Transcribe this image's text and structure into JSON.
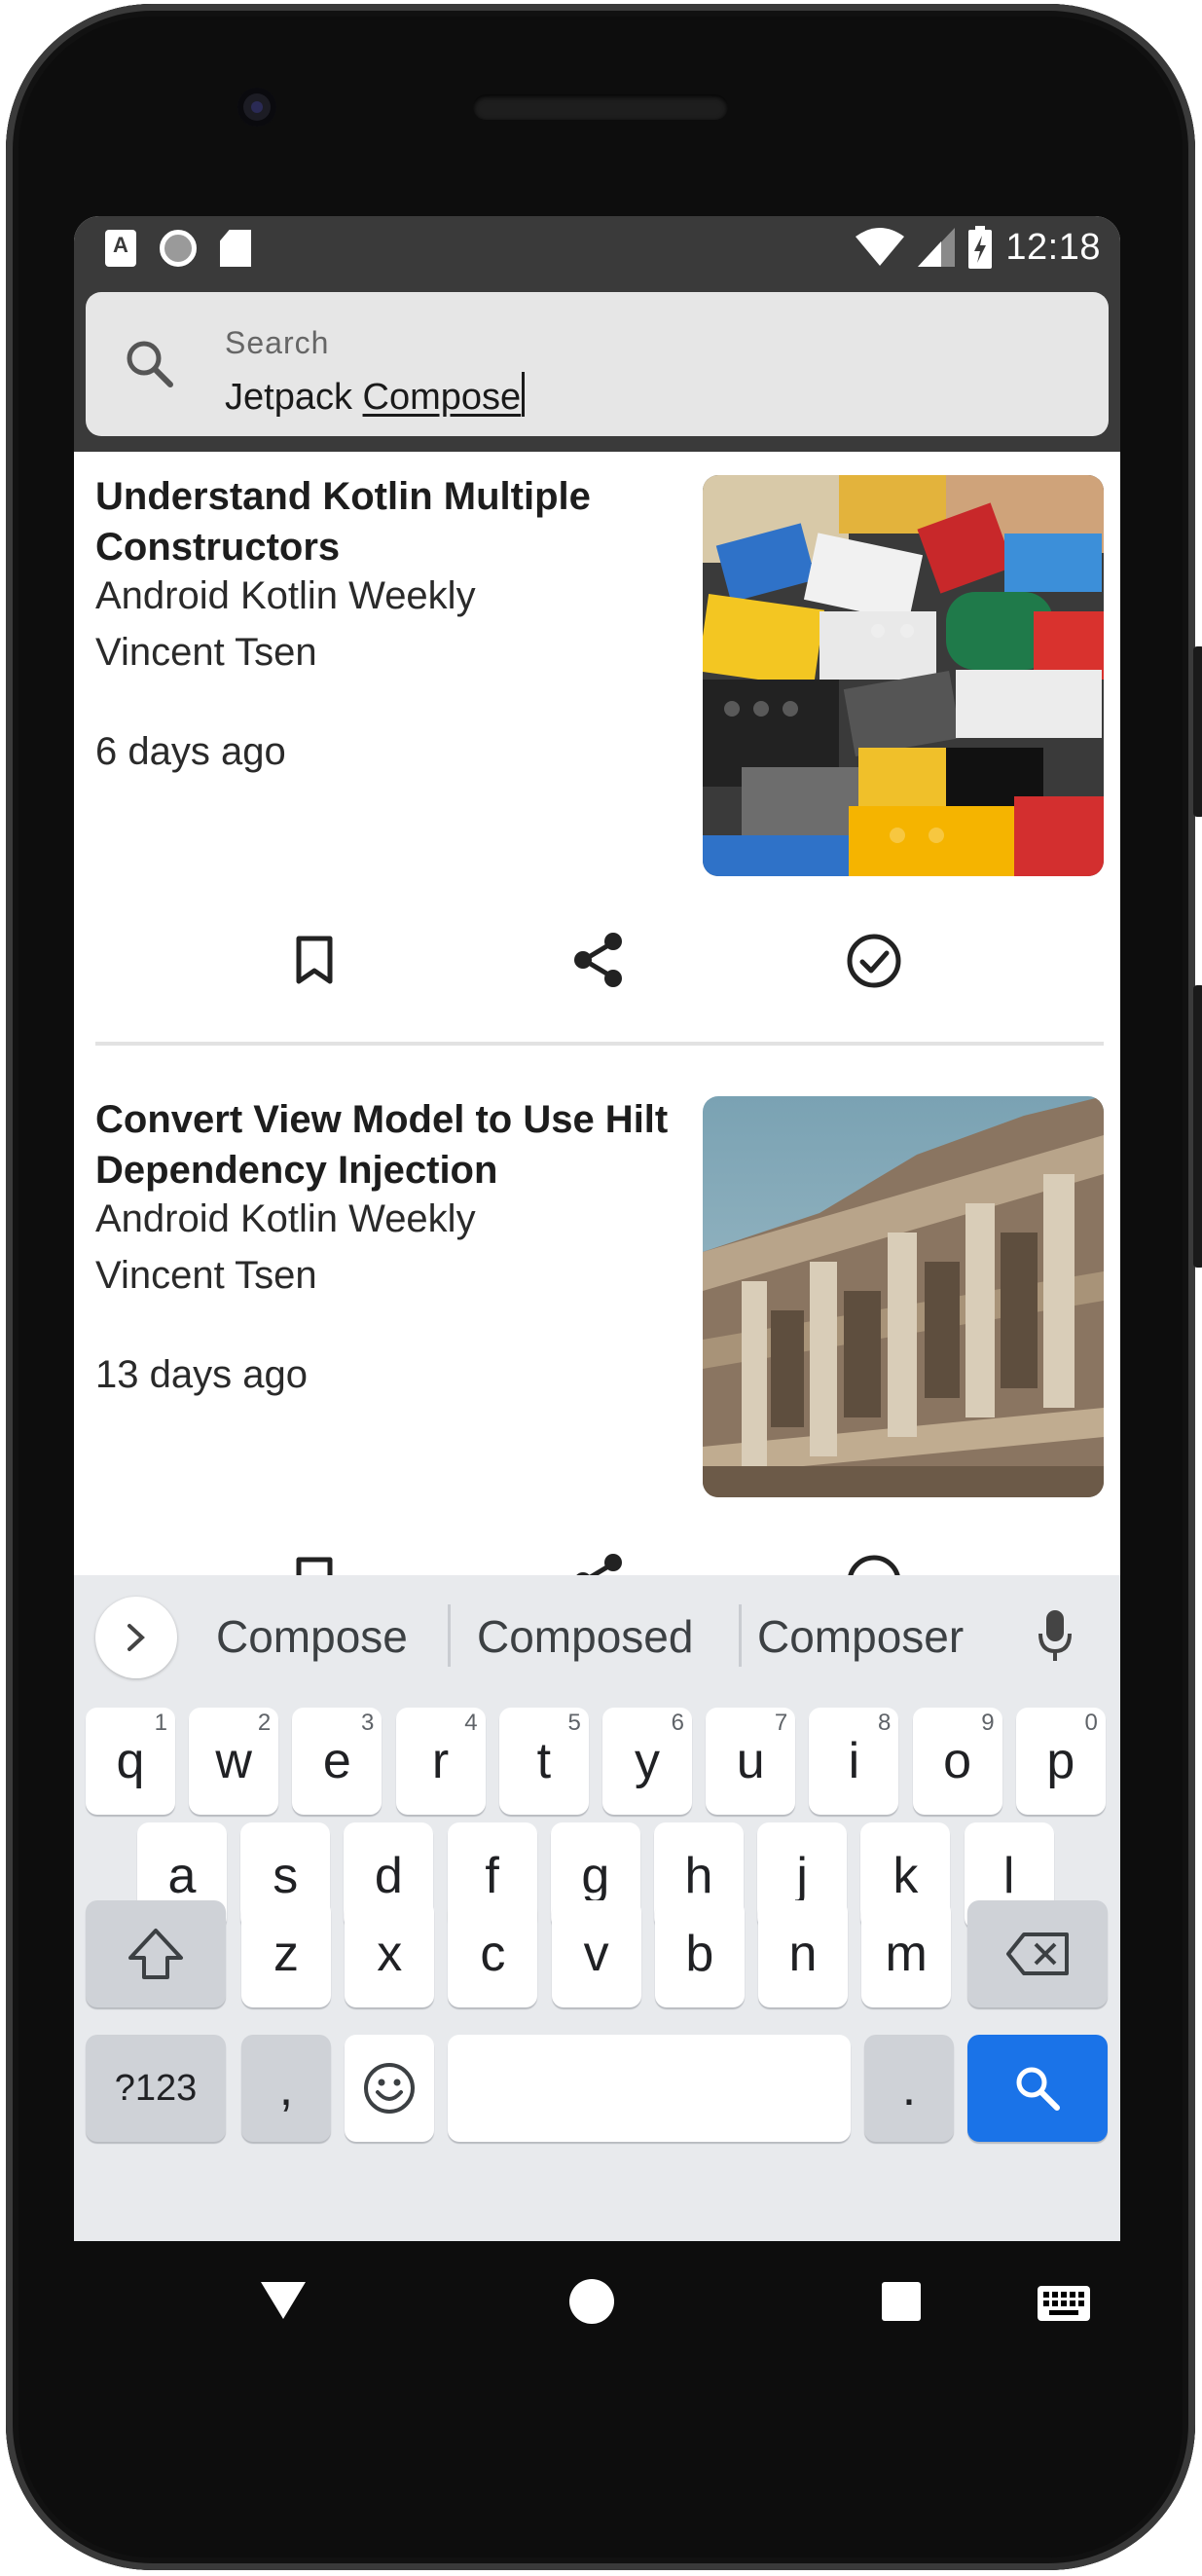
{
  "status_bar": {
    "time": "12:18",
    "left_icons": [
      "text-a-icon",
      "circle-icon",
      "sd-card-icon"
    ],
    "right_icons": [
      "wifi-icon",
      "signal-icon",
      "battery-charging-icon"
    ]
  },
  "search": {
    "label": "Search",
    "value_prefix": "Jetpack ",
    "value_underlined": "Compose"
  },
  "articles": [
    {
      "title": "Understand Kotlin Multiple Constructors",
      "source": "Android Kotlin Weekly",
      "author": "Vincent Tsen",
      "date": "6 days ago",
      "image": "lego-bricks-photo"
    },
    {
      "title": "Convert View Model to Use Hilt Dependency Injection",
      "source": "Android Kotlin Weekly",
      "author": "Vincent Tsen",
      "date": "13 days ago",
      "image": "ancient-library-facade-photo"
    }
  ],
  "article_actions": [
    "bookmark-icon",
    "share-icon",
    "mark-read-icon"
  ],
  "keyboard": {
    "suggestions": [
      "Compose",
      "Composed",
      "Composer"
    ],
    "row1": [
      "q",
      "w",
      "e",
      "r",
      "t",
      "y",
      "u",
      "i",
      "o",
      "p"
    ],
    "row1_hints": [
      "1",
      "2",
      "3",
      "4",
      "5",
      "6",
      "7",
      "8",
      "9",
      "0"
    ],
    "row2": [
      "a",
      "s",
      "d",
      "f",
      "g",
      "h",
      "j",
      "k",
      "l"
    ],
    "row3": [
      "z",
      "x",
      "c",
      "v",
      "b",
      "n",
      "m"
    ],
    "symbols_label": "?123",
    "comma_label": ",",
    "period_label": ".",
    "accent_color": "#1a73e8"
  },
  "nav_bar": [
    "back-icon",
    "home-icon",
    "recents-icon",
    "keyboard-switch-icon"
  ]
}
